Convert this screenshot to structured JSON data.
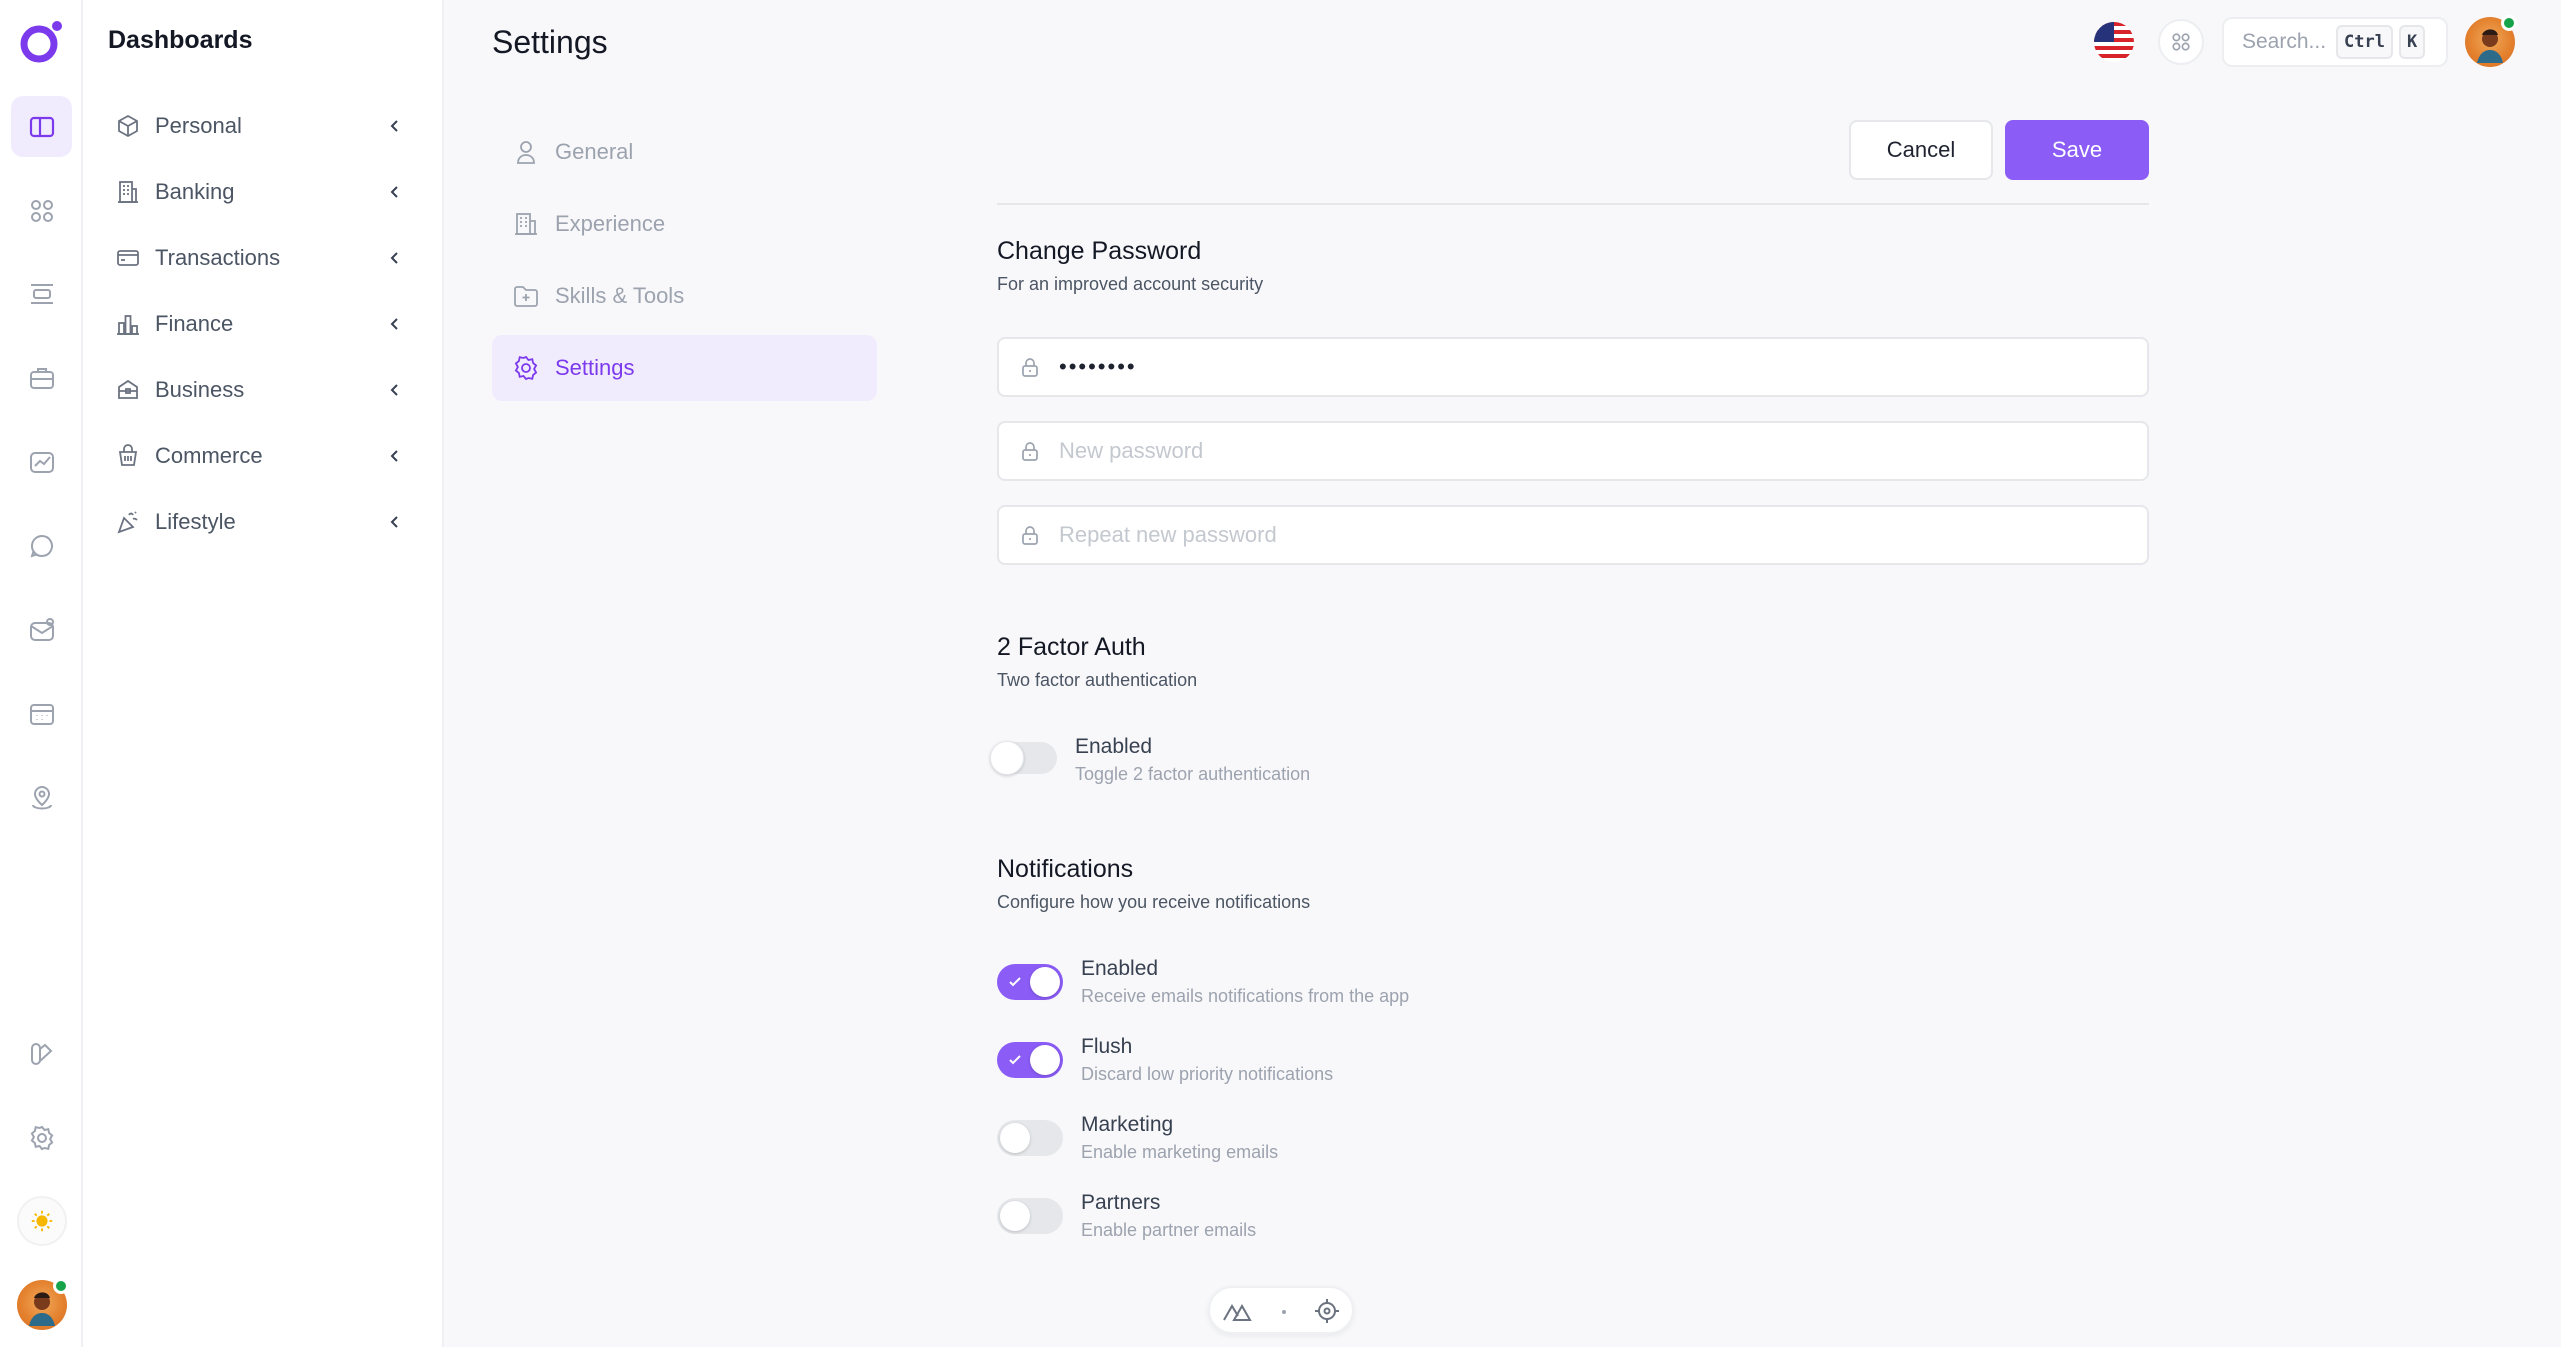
{
  "sidebar": {
    "title": "Dashboards",
    "items": [
      {
        "label": "Personal",
        "icon": "cube-icon"
      },
      {
        "label": "Banking",
        "icon": "building-icon"
      },
      {
        "label": "Transactions",
        "icon": "credit-card-icon"
      },
      {
        "label": "Finance",
        "icon": "bar-chart-icon"
      },
      {
        "label": "Business",
        "icon": "briefcase-icon"
      },
      {
        "label": "Commerce",
        "icon": "shopping-basket-icon"
      },
      {
        "label": "Lifestyle",
        "icon": "party-icon"
      }
    ]
  },
  "rail": {
    "icons": [
      "sidebar-panel-icon",
      "apps-grid-icon",
      "layout-icon",
      "briefcase-icon",
      "analytics-icon",
      "chat-icon",
      "mail-icon",
      "calendar-icon",
      "map-pin-icon",
      "brush-icon",
      "gear-icon",
      "sun-icon"
    ]
  },
  "header": {
    "title": "Settings",
    "search_placeholder": "Search...",
    "kbd_ctrl": "Ctrl",
    "kbd_k": "K"
  },
  "tabs": [
    {
      "label": "General",
      "icon": "user-icon",
      "active": false
    },
    {
      "label": "Experience",
      "icon": "building-icon",
      "active": false
    },
    {
      "label": "Skills & Tools",
      "icon": "folder-plus-icon",
      "active": false
    },
    {
      "label": "Settings",
      "icon": "gear-icon",
      "active": true
    }
  ],
  "actions": {
    "cancel": "Cancel",
    "save": "Save"
  },
  "password": {
    "title": "Change Password",
    "subtitle": "For an improved account security",
    "current_value": "••••••••",
    "new_placeholder": "New password",
    "repeat_placeholder": "Repeat new password"
  },
  "two_factor": {
    "title": "2 Factor Auth",
    "subtitle": "Two factor authentication",
    "toggle_label": "Enabled",
    "toggle_sub": "Toggle 2 factor authentication",
    "enabled": false
  },
  "notifications": {
    "title": "Notifications",
    "subtitle": "Configure how you receive notifications",
    "items": [
      {
        "label": "Enabled",
        "sub": "Receive emails notifications from the app",
        "on": true
      },
      {
        "label": "Flush",
        "sub": "Discard low priority notifications",
        "on": true
      },
      {
        "label": "Marketing",
        "sub": "Enable marketing emails",
        "on": false
      },
      {
        "label": "Partners",
        "sub": "Enable partner emails",
        "on": false
      }
    ]
  },
  "colors": {
    "accent": "#8b5cf6",
    "accent_soft": "#f1ebfe"
  }
}
